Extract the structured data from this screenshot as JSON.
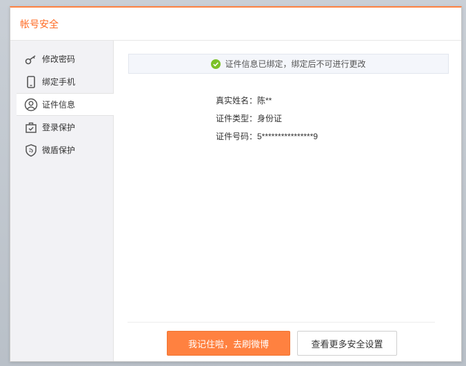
{
  "dialog": {
    "title": "帐号安全"
  },
  "sidebar": {
    "items": [
      {
        "label": "修改密码",
        "icon": "key-icon"
      },
      {
        "label": "绑定手机",
        "icon": "phone-icon"
      },
      {
        "label": "证件信息",
        "icon": "user-icon",
        "active": true
      },
      {
        "label": "登录保护",
        "icon": "briefcase-check-icon"
      },
      {
        "label": "微盾保护",
        "icon": "shield-icon"
      }
    ]
  },
  "main": {
    "notice": "证件信息已绑定，绑定后不可进行更改",
    "info": {
      "real_name": "真实姓名：陈**",
      "id_type": "证件类型：身份证",
      "id_number": "证件号码：5****************9"
    }
  },
  "footer": {
    "primary_label": "我记住啦，去刷微博",
    "secondary_label": "查看更多安全设置"
  },
  "colors": {
    "accent": "#ff8140",
    "title": "#ff6a22",
    "success": "#7cc128"
  }
}
